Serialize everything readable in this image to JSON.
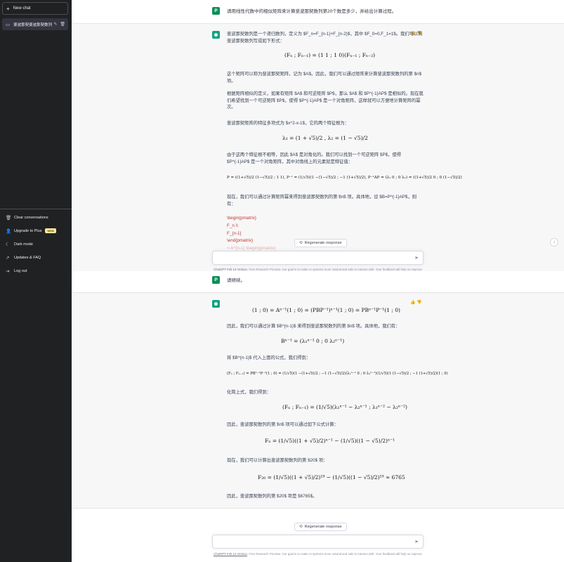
{
  "sidebar": {
    "new_chat": "New chat",
    "new_chat_icon": "plus-icon",
    "conversation": "斐波那契斐波那契数列",
    "bottom": [
      {
        "icon": "trash-icon",
        "glyph": "🗑",
        "label": "Clear conversations"
      },
      {
        "icon": "user-icon",
        "glyph": "👤",
        "label": "Upgrade to Plus",
        "badge": "NEW"
      },
      {
        "icon": "moon-icon",
        "glyph": "☾",
        "label": "Dark mode"
      },
      {
        "icon": "external-link-icon",
        "glyph": "↗",
        "label": "Updates & FAQ"
      },
      {
        "icon": "logout-icon",
        "glyph": "⇥",
        "label": "Log out"
      }
    ]
  },
  "avatar": {
    "user": "P"
  },
  "messages": {
    "q1": "请用线性代数中的相似矩阵来计算斐波那契数列第20个数是多少，并给出计算过程。",
    "a1": {
      "p1": "斐波那契数列是一个递归数列，定义为 $F_n=F_{n-1}+F_{n-2}$，其中 $F_0=0,F_1=1$。我们可以将斐波那契数列写成如下形式：",
      "p2": "这个矩阵可以称为斐波那契矩阵，记为 $A$。因此，我们可以通过矩阵来计算斐波那契数列的第 $n$ 项。",
      "p3": "根据矩阵相似的定义，如果有矩阵 $A$ 和可逆矩阵 $P$，那么 $A$ 和 $P^{-1}AP$ 是相似的。现在我们希望找到一个可逆矩阵 $P$，使得 $P^{-1}AP$ 是一个对角矩阵，这样就可以方便地计算矩阵的幂次。",
      "p4": "斐波那契矩阵的特征多项式为 $x^2-x-1$，它的两个特征根为：",
      "p5": "由于这两个特征根不相等，因此 $A$ 是对角化的。我们可以找到一个可逆矩阵 $P$，使得 $P^{-1}AP$ 是一个对角矩阵，其中对角线上的元素就是特征值：",
      "p6": "现在，我们可以通过计算矩阵幂来得到斐波那契数列的第 $n$ 项。具体地，设 $B=P^{-1}AP$，则有：",
      "code": [
        "\\begin{pmatrix}",
        "F_n \\\\",
        "F_{n-1}",
        "\\end{pmatrix}",
        "= A^{n-1} \\begin{pmatrix}"
      ]
    },
    "q2": "请继续。",
    "a2": {
      "p1": "因此，我们可以通过计算 $B^{n-1}$ 来得到斐波那契数列的第 $n$ 项。具体地，我们有：",
      "p2": "将 $B^{n-1}$ 代入上面的公式，我们得到：",
      "p3": "化简上式，我们得到：",
      "p4": "因此，斐波那契数列的第 $n$ 项可以通过如下公式计算：",
      "p5": "现在，我们可以计算出斐波那契数列的第 $20$ 项：",
      "p6": "因此，斐波那契数列的第 $20$ 项是 $6765$。"
    }
  },
  "math": {
    "m1": "(Fₙ ; Fₙ₋₁) = (1 1 ; 1 0)(Fₙ₋₁ ; Fₙ₋₂)",
    "m2": "λ₁ = (1 + √5)/2 ,   λ₂ = (1 − √5)/2",
    "m3": "P = ((1+√5)/2  (1−√5)/2 ; 1  1),   P⁻¹ = (1/√5)(1  −(1−√5)/2 ; −1  (1+√5)/2),   P⁻¹AP = (λ₁ 0 ; 0 λ₂) = ((1+√5)/2  0 ; 0  (1−√5)/2)",
    "m4": "(1 ; 0) = Aⁿ⁻¹(1 ; 0) = (PBP⁻¹)ⁿ⁻¹(1 ; 0) = PBⁿ⁻¹P⁻¹(1 ; 0)",
    "m5": "Bⁿ⁻¹ = (λ₁ⁿ⁻¹  0 ; 0  λ₂ⁿ⁻¹)",
    "m6": "(Fₙ ; Fₙ₋₁) = PBⁿ⁻¹P⁻¹(1 ; 0) = (1/√5)(1  −(1+√5)/2 ; −1  (1−√5)/2)(λ₁ⁿ⁻¹ 0 ; 0 λ₂ⁿ⁻¹)(1/√5)(1  (1−√5)/2 ; −1  (1+√5)/2)(1 ; 0)",
    "m7": "(Fₙ ; Fₙ₋₁) = (1/√5)(λ₁ⁿ⁻¹ − λ₂ⁿ⁻¹ ; λ₁ⁿ⁻² − λ₂ⁿ⁻²)",
    "m8": "Fₙ = (1/√5)((1 + √5)/2)ⁿ⁻¹ − (1/√5)((1 − √5)/2)ⁿ⁻¹",
    "m9": "F₂₀ = (1/√5)((1 + √5)/2)¹⁹ − (1/√5)((1 − √5)/2)¹⁹ ≈ 6765"
  },
  "ui": {
    "regenerate": "Regenerate response",
    "footer_link": "ChatGPT Feb 13 Version",
    "footer_text": ". Free Research Preview. Our goal is to make AI systems more natural and safe to interact with. Your feedback will help us improve."
  }
}
